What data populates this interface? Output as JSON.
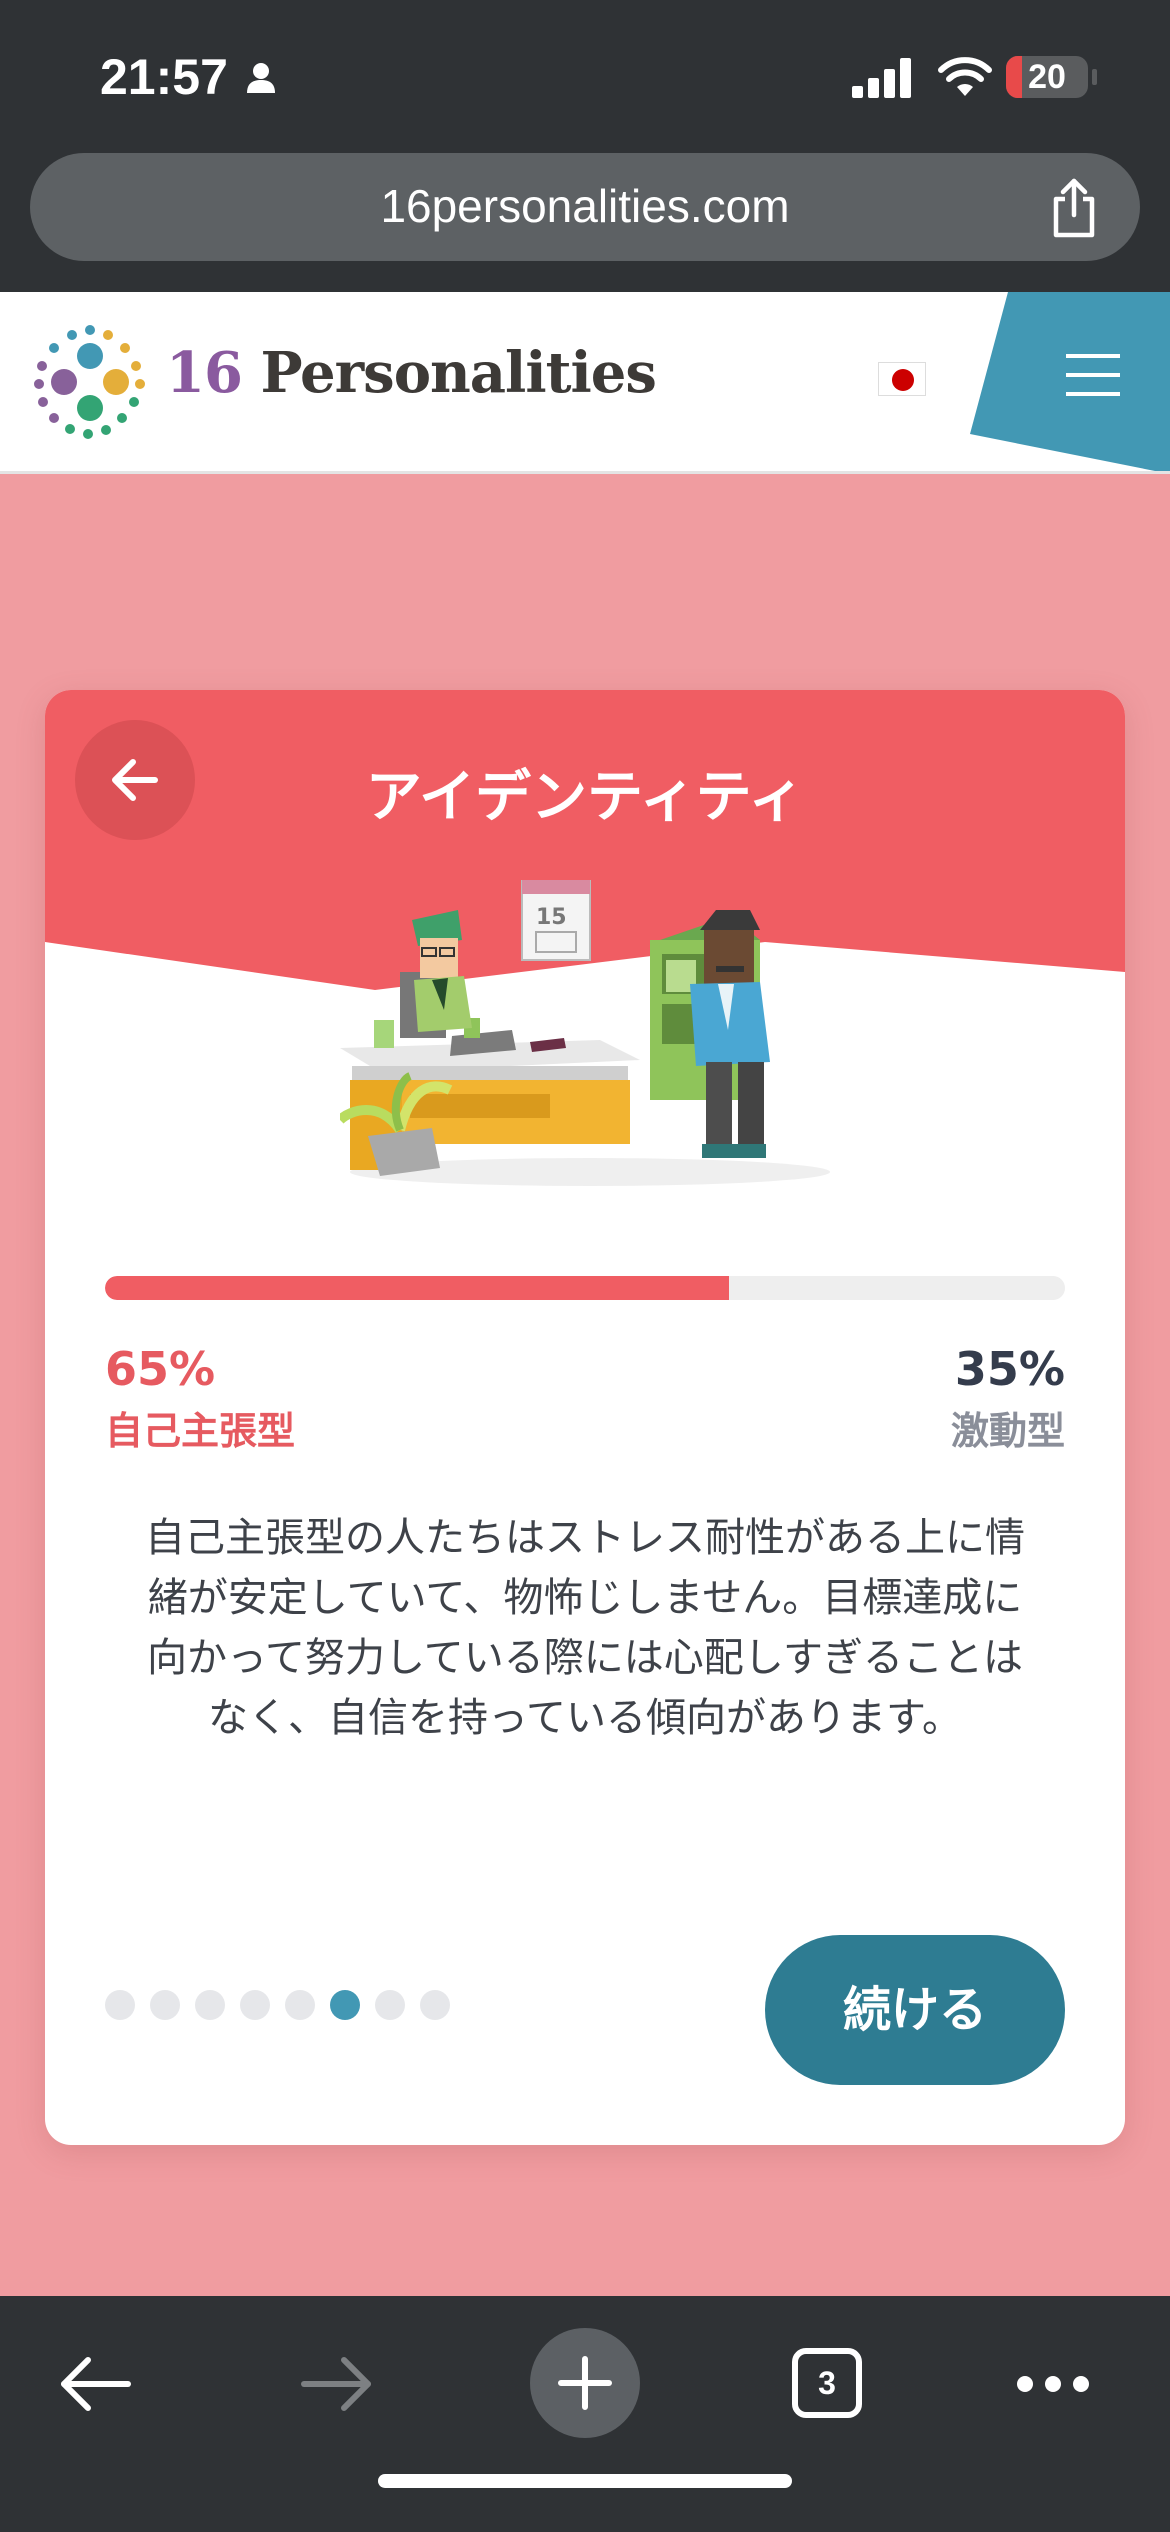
{
  "status_bar": {
    "time": "21:57",
    "battery_level": "20",
    "icons": [
      "person-icon",
      "signal-icon",
      "wifi-icon",
      "battery-icon"
    ]
  },
  "browser": {
    "url": "16personalities.com",
    "share_icon": "share-icon",
    "toolbar": {
      "tab_count": "3",
      "icons": [
        "back-arrow-icon",
        "forward-arrow-icon",
        "plus-icon",
        "tabs-icon",
        "more-icon"
      ]
    }
  },
  "site": {
    "brand_number": "16",
    "brand_name": "Personalities",
    "flag_icon": "japan-flag-icon",
    "menu_icon": "hamburger-menu-icon"
  },
  "card": {
    "title": "アイデンティティ",
    "back_icon": "back-arrow-icon",
    "progress": {
      "left_percent": "65%",
      "left_label": "自己主張型",
      "right_percent": "35%",
      "right_label": "激動型",
      "fill_fraction": 0.65
    },
    "description_lines": [
      "自己主張型の人たちはストレス耐性がある上に情",
      "緒が安定していて、物怖じしません。目標達成に",
      "向かって努力している際には心配しすぎることは",
      "なく、自信を持っている傾向があります。"
    ],
    "pagination": {
      "total": 8,
      "active": 6
    },
    "continue_label": "続ける"
  },
  "colors": {
    "accent_red": "#f05d63",
    "teal_button": "#2e7c92",
    "page_bg": "#f09ca0",
    "active_dot": "#4298b4"
  }
}
